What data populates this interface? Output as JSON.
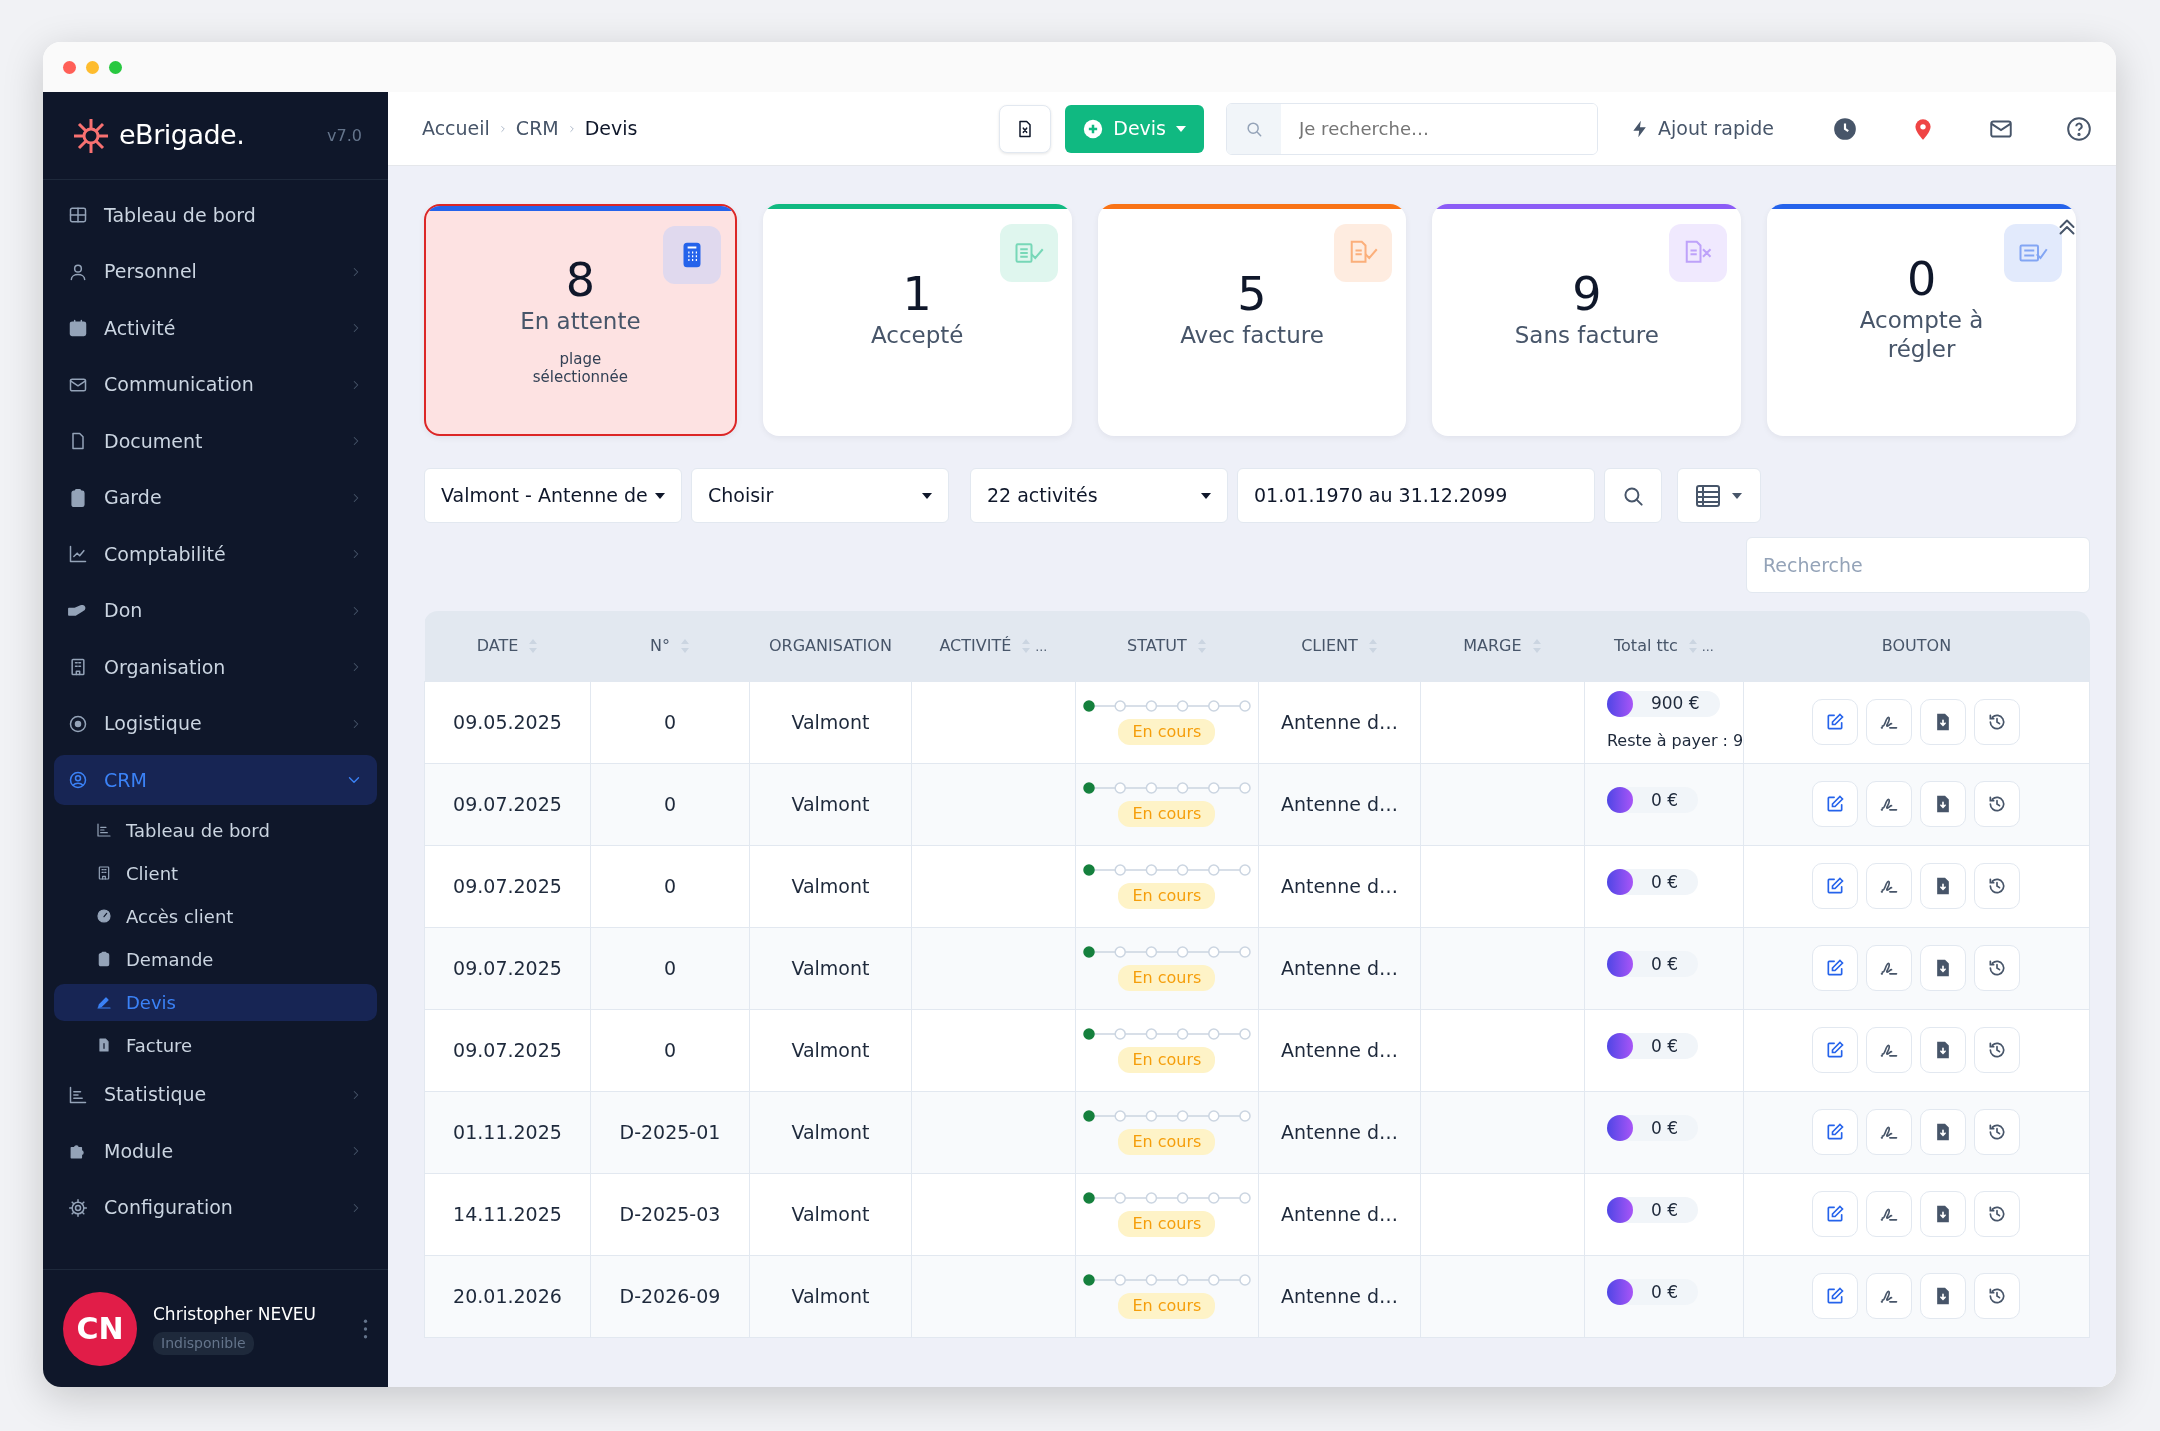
{
  "sidebar": {
    "logo": "eBrigade.",
    "version": "v7.0",
    "items": [
      {
        "label": "Tableau de bord",
        "selected": false
      },
      {
        "label": "Personnel",
        "selected": false,
        "expanded": false
      },
      {
        "label": "Activité",
        "selected": false,
        "expanded": false
      },
      {
        "label": "Communication",
        "selected": false,
        "expanded": false
      },
      {
        "label": "Document",
        "selected": false,
        "expanded": false
      },
      {
        "label": "Garde",
        "selected": false,
        "expanded": false
      },
      {
        "label": "Comptabilité",
        "selected": false,
        "expanded": false
      },
      {
        "label": "Don",
        "selected": false,
        "expanded": false
      },
      {
        "label": "Organisation",
        "selected": false,
        "expanded": false
      },
      {
        "label": "Logistique",
        "selected": false,
        "expanded": false
      },
      {
        "label": "CRM",
        "selected": true,
        "expanded": true,
        "children": [
          {
            "label": "Tableau de bord",
            "selected": false
          },
          {
            "label": "Client",
            "selected": false
          },
          {
            "label": "Accès client",
            "selected": false
          },
          {
            "label": "Demande",
            "selected": false
          },
          {
            "label": "Devis",
            "selected": true
          },
          {
            "label": "Facture",
            "selected": false
          }
        ]
      },
      {
        "label": "Statistique",
        "selected": false,
        "expanded": false
      },
      {
        "label": "Module",
        "selected": false,
        "expanded": false
      },
      {
        "label": "Configuration",
        "selected": false,
        "expanded": false
      }
    ],
    "user": {
      "initials": "CN",
      "name": "Christopher NEVEU",
      "status": "Indisponible"
    }
  },
  "header": {
    "breadcrumb": [
      "Accueil",
      "CRM",
      "Devis"
    ],
    "new_button": "Devis",
    "search": {
      "placeholder": "Je recherche…"
    },
    "quick_add": "Ajout rapide"
  },
  "cards": [
    {
      "value": "8",
      "label": "En attente",
      "note": "plage sélectionnée",
      "selected": true,
      "color": "#2563eb"
    },
    {
      "value": "1",
      "label": "Accepté",
      "selected": false,
      "color": "#10b981"
    },
    {
      "value": "5",
      "label": "Avec facture",
      "selected": false,
      "color": "#f97316"
    },
    {
      "value": "9",
      "label": "Sans facture",
      "selected": false,
      "color": "#8b5cf6"
    },
    {
      "value": "0",
      "label": "Acompte à régler",
      "selected": false,
      "color": "#2563eb"
    }
  ],
  "filters": {
    "selects": [
      "Valmont - Antenne de",
      "Choisir",
      "22 activités"
    ],
    "date_range": "01.01.1970 au 31.12.2099",
    "table_search": {
      "placeholder": "Recherche"
    }
  },
  "table": {
    "columns": [
      {
        "label": "DATE",
        "sortable": true
      },
      {
        "label": "N°",
        "sortable": true
      },
      {
        "label": "ORGANISATION",
        "sortable": false
      },
      {
        "label": "ACTIVITÉ",
        "sortable": true,
        "more": "…"
      },
      {
        "label": "STATUT",
        "sortable": true
      },
      {
        "label": "CLIENT",
        "sortable": true
      },
      {
        "label": "MARGE",
        "sortable": true
      },
      {
        "label": "Total ttc",
        "sortable": true,
        "more": "…"
      },
      {
        "label": "BOUTON",
        "sortable": false
      }
    ],
    "rows": [
      {
        "date": "09.05.2025",
        "number": "0",
        "organisation": "Valmont",
        "status": {
          "label": "En cours"
        },
        "client": "Antenne d…",
        "total": "900 €",
        "remaining": "Reste à payer : 9"
      },
      {
        "date": "09.07.2025",
        "number": "0",
        "organisation": "Valmont",
        "status": {
          "label": "En cours"
        },
        "client": "Antenne d…",
        "total": "0 €"
      },
      {
        "date": "09.07.2025",
        "number": "0",
        "organisation": "Valmont",
        "status": {
          "label": "En cours"
        },
        "client": "Antenne d…",
        "total": "0 €"
      },
      {
        "date": "09.07.2025",
        "number": "0",
        "organisation": "Valmont",
        "status": {
          "label": "En cours"
        },
        "client": "Antenne d…",
        "total": "0 €"
      },
      {
        "date": "09.07.2025",
        "number": "0",
        "organisation": "Valmont",
        "status": {
          "label": "En cours"
        },
        "client": "Antenne d…",
        "total": "0 €"
      },
      {
        "date": "01.11.2025",
        "number": "D-2025-01",
        "organisation": "Valmont",
        "status": {
          "label": "En cours"
        },
        "client": "Antenne d…",
        "total": "0 €"
      },
      {
        "date": "14.11.2025",
        "number": "D-2025-03",
        "organisation": "Valmont",
        "status": {
          "label": "En cours"
        },
        "client": "Antenne d…",
        "total": "0 €"
      },
      {
        "date": "20.01.2026",
        "number": "D-2026-09",
        "organisation": "Valmont",
        "status": {
          "label": "En cours"
        },
        "client": "Antenne d…",
        "total": "0 €"
      }
    ]
  }
}
